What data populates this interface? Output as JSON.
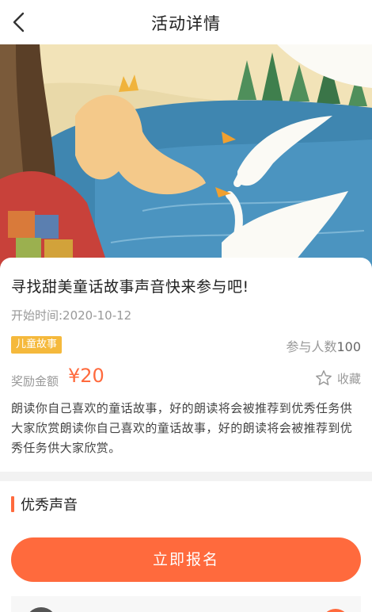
{
  "nav": {
    "title": "活动详情"
  },
  "activity": {
    "title": "寻找甜美童话故事声音快来参与吧!",
    "start_time": "开始时间:2020-10-12",
    "tag": "儿童故事",
    "participants_label": "参与人数",
    "participants_count": "100",
    "reward_label": "奖励金额",
    "reward_value": "¥20",
    "favorite_label": "收藏",
    "description": "朗读你自己喜欢的童话故事，好的朗读将会被推荐到优秀任务供大家欣赏朗读你自己喜欢的童话故事，好的朗读将会被推荐到优秀任务供大家欣赏。"
  },
  "section": {
    "title": "优秀声音"
  },
  "signup_button": "立即报名",
  "colors": {
    "accent": "#ff6a3d",
    "tag": "#f5b93c",
    "muted": "#999999"
  }
}
